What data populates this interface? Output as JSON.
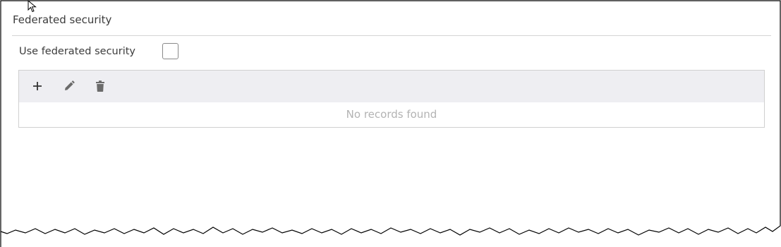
{
  "section": {
    "title": "Federated security"
  },
  "federated": {
    "label": "Use federated security",
    "checked": false
  },
  "grid": {
    "toolbar": {
      "add_icon": "plus-icon",
      "edit_icon": "pencil-icon",
      "delete_icon": "trash-icon"
    },
    "empty_message": "No records found"
  },
  "colors": {
    "toolbar_bg": "#eeeef2",
    "empty_text": "#b3b3b3",
    "icon": "#666666"
  }
}
